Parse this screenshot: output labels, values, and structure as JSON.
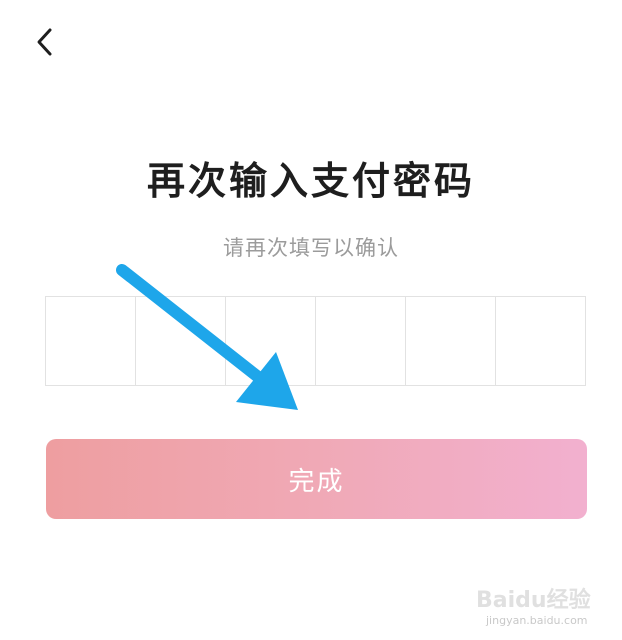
{
  "header": {
    "back_icon": "chevron-left-icon"
  },
  "main": {
    "title": "再次输入支付密码",
    "subtitle": "请再次填写以确认",
    "pin_cells": [
      "",
      "",
      "",
      "",
      "",
      ""
    ],
    "done_label": "完成"
  },
  "colors": {
    "button_gradient_start": "#ee9ea0",
    "button_gradient_end": "#f2b0cf",
    "arrow": "#1ea6ea",
    "title": "#1e1e1e",
    "subtitle": "#9b9b9b"
  },
  "watermark": {
    "brand": "Baidu经验",
    "url": "jingyan.baidu.com"
  }
}
